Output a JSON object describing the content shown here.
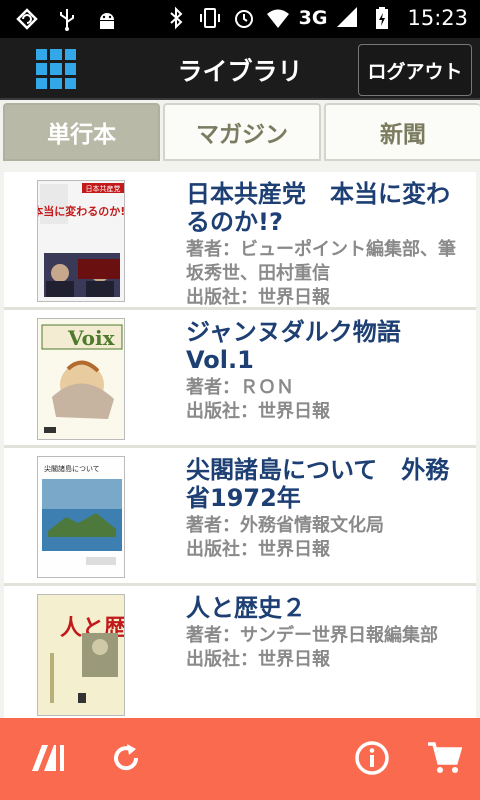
{
  "status_bar": {
    "network": "3G",
    "time": "15:23",
    "icons": [
      "sync-icon",
      "usb-icon",
      "android-icon",
      "bluetooth-icon",
      "vibrate-icon",
      "alarm-icon",
      "wifi-icon",
      "signal-icon",
      "battery-icon"
    ]
  },
  "action_bar": {
    "title": "ライブラリ",
    "logout_label": "ログアウト",
    "menu_icon": "grid-icon",
    "accent": "#33a8e8"
  },
  "tabs": [
    {
      "label": "単行本",
      "active": true
    },
    {
      "label": "マガジン",
      "active": false
    },
    {
      "label": "新聞",
      "active": false
    }
  ],
  "books": [
    {
      "title": "日本共産党　本当に変わるのか!?",
      "author": "著者：ビューポイント編集部、筆坂秀世、田村重信",
      "publisher": "出版社：世界日報"
    },
    {
      "title": "ジャンヌダルク物語 Vol.1",
      "author": "著者：ＲＯＮ",
      "publisher": "出版社：世界日報"
    },
    {
      "title": "尖閣諸島について　外務省1972年",
      "author": "著者：外務省情報文化局",
      "publisher": "出版社：世界日報"
    },
    {
      "title": "人と歴史２",
      "author": "著者：サンデー世界日報編集部",
      "publisher": "出版社：世界日報"
    }
  ],
  "covers": {
    "book1": {
      "band": "日本共産党",
      "line": "本当に変わるのか!?"
    },
    "book2": {
      "logo": "Voix"
    },
    "book3": {
      "caption": "尖閣諸島について"
    },
    "book4": {
      "caption": "人と歴史"
    }
  },
  "bottom_bar": {
    "color": "#fa6a4f",
    "icons": [
      "bookshelf-icon",
      "refresh-icon",
      "info-icon",
      "cart-icon"
    ]
  }
}
